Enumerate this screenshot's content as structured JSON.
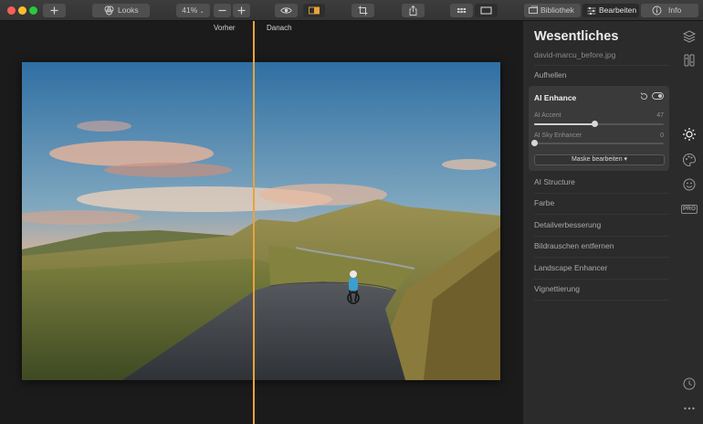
{
  "toolbar": {
    "looks_label": "Looks",
    "zoom_value": "41%",
    "library_label": "Bibliothek",
    "edit_label": "Bearbeiten",
    "info_label": "Info"
  },
  "view": {
    "before_label": "Vorher",
    "after_label": "Danach",
    "split_position": 0.4843
  },
  "panel": {
    "title": "Wesentliches",
    "file_name": "david-marcu_before.jpg",
    "sections_top": [
      "Aufhellen"
    ],
    "ai_enhance": {
      "title": "AI Enhance",
      "enabled": true,
      "sliders": [
        {
          "label": "AI Accent",
          "value": 47,
          "min": 0,
          "max": 100
        },
        {
          "label": "AI Sky Enhancer",
          "value": 0,
          "min": 0,
          "max": 100
        }
      ],
      "mask_button": "Maske bearbeiten"
    },
    "sections": [
      "AI Structure",
      "Farbe",
      "Detailverbesserung",
      "Bildrauschen entfernen",
      "Landscape Enhancer",
      "Vignettierung"
    ]
  },
  "rail": {
    "icons": [
      "layers-icon",
      "presets-icon",
      "sun-icon",
      "palette-icon",
      "face-icon",
      "pro-icon",
      "history-icon",
      "more-icon"
    ],
    "pro_label": "PRO",
    "active_icon": "sun-icon"
  },
  "colors": {
    "accent": "#e9a33a",
    "panel_bg": "#2b2b2b",
    "card_bg": "#3a3a3a",
    "canvas_bg": "#1b1b1b"
  }
}
